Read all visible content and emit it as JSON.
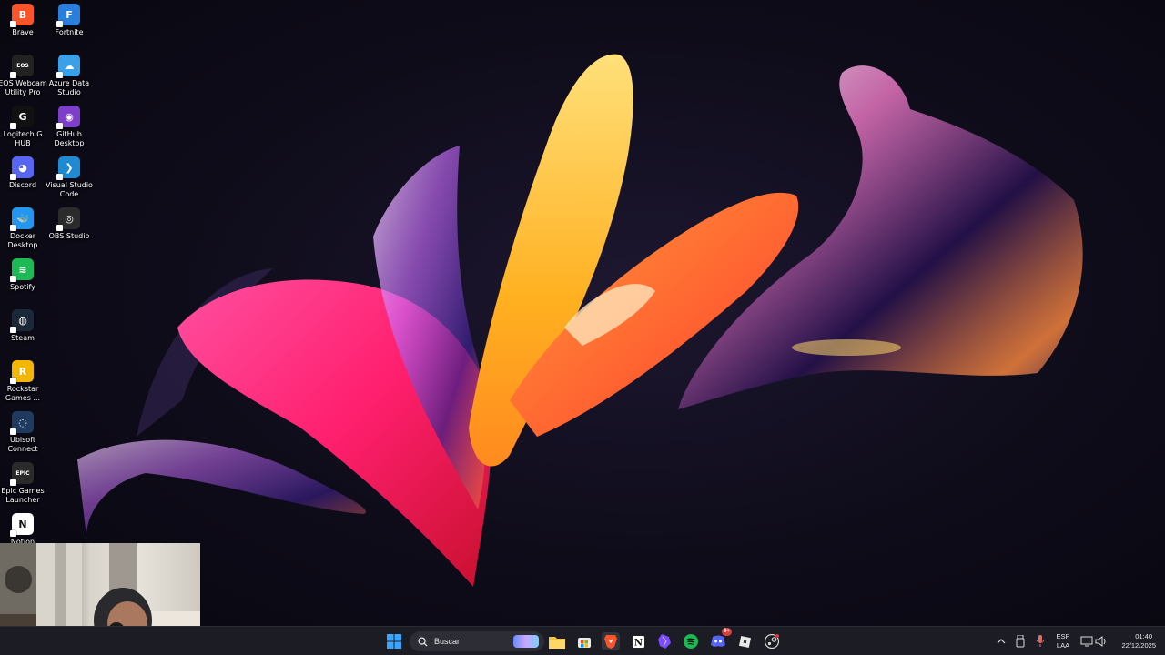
{
  "desktop_icons": [
    {
      "name": "brave",
      "label": "Brave",
      "glyph": "B",
      "color": "#fb542b"
    },
    {
      "name": "fortnite",
      "label": "Fortnite",
      "glyph": "F",
      "color": "#2b7fdc"
    },
    {
      "name": "eos-webcam-utility",
      "label": "EOS Webcam Utility Pro",
      "glyph": "EOS",
      "color": "#222222"
    },
    {
      "name": "azure-data-studio",
      "label": "Azure Data Studio",
      "glyph": "☁",
      "color": "#3aa0e8"
    },
    {
      "name": "logitech-g-hub",
      "label": "Logitech G HUB",
      "glyph": "G",
      "color": "#111111"
    },
    {
      "name": "github-desktop",
      "label": "GitHub Desktop",
      "glyph": "◉",
      "color": "#7d3fc9"
    },
    {
      "name": "discord",
      "label": "Discord",
      "glyph": "◕",
      "color": "#5865f2"
    },
    {
      "name": "visual-studio-code",
      "label": "Visual Studio Code",
      "glyph": "❯",
      "color": "#1f8ad2"
    },
    {
      "name": "docker-desktop",
      "label": "Docker Desktop",
      "glyph": "🐳",
      "color": "#2496ed"
    },
    {
      "name": "obs-studio",
      "label": "OBS Studio",
      "glyph": "◎",
      "color": "#2b2b2b"
    },
    {
      "name": "spotify",
      "label": "Spotify",
      "glyph": "≋",
      "color": "#1db954"
    },
    {
      "name": "steam",
      "label": "Steam",
      "glyph": "◍",
      "color": "#1b2838"
    },
    {
      "name": "rockstar-games",
      "label": "Rockstar Games ...",
      "glyph": "R",
      "color": "#f2b705"
    },
    {
      "name": "ubisoft-connect",
      "label": "Ubisoft Connect",
      "glyph": "◌",
      "color": "#1e3a5f"
    },
    {
      "name": "epic-games-launcher",
      "label": "Epic Games Launcher",
      "glyph": "EPIC",
      "color": "#2a2a2a"
    },
    {
      "name": "notion",
      "label": "Notion",
      "glyph": "N",
      "color": "#ffffff"
    }
  ],
  "taskbar": {
    "search_placeholder": "Buscar",
    "apps": [
      "start",
      "file-explorer",
      "microsoft-store",
      "brave",
      "notion",
      "obsidian",
      "spotify",
      "discord",
      "roblox",
      "steam"
    ],
    "discord_badge": "9+"
  },
  "tray": {
    "language_top": "ESP",
    "language_bottom": "LAA",
    "time": "01:40",
    "date": "22/12/2025"
  },
  "colors": {
    "taskbar_bg": "#1c1c24",
    "accent_pink": "#ff2d8a",
    "accent_orange": "#ff8a1f",
    "accent_yellow": "#ffc93c"
  }
}
